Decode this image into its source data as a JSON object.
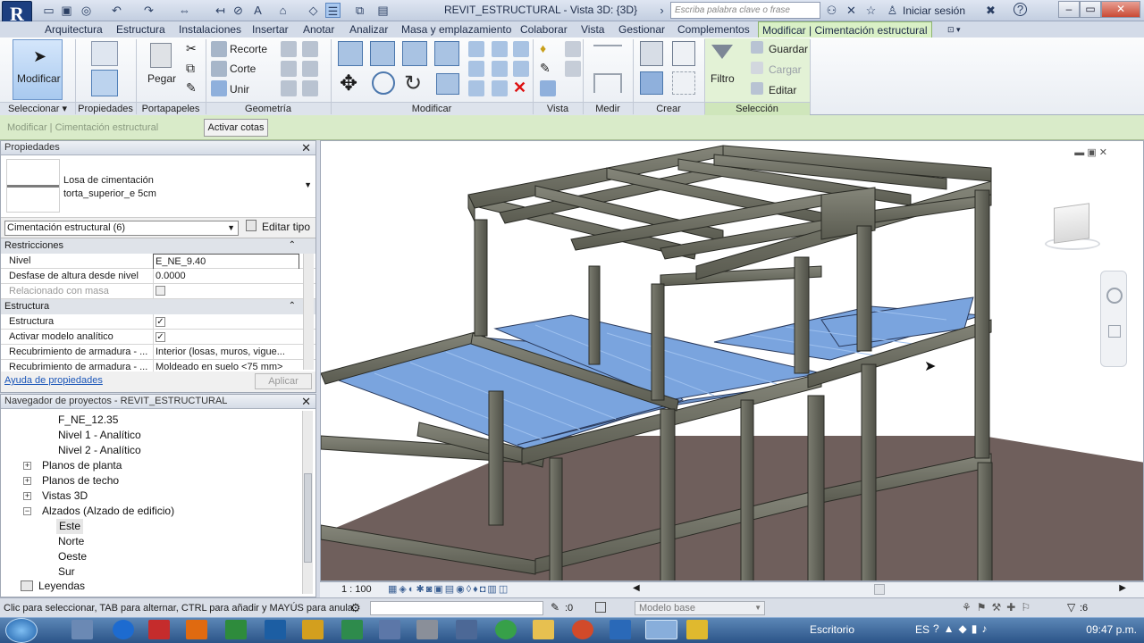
{
  "titlebar": {
    "title": "REVIT_ESTRUCTURAL - Vista 3D: {3D}",
    "search_placeholder": "Escriba palabra clave o frase",
    "signin": "Iniciar sesión"
  },
  "tabs": [
    "Arquitectura",
    "Estructura",
    "Instalaciones",
    "Insertar",
    "Anotar",
    "Analizar",
    "Masa y emplazamiento",
    "Colaborar",
    "Vista",
    "Gestionar",
    "Complementos",
    "Modificar | Cimentación estructural"
  ],
  "ribbon": {
    "modificar": "Modificar",
    "pegar": "Pegar",
    "recorte": "Recorte",
    "corte": "Corte",
    "unir": "Unir",
    "filtro": "Filtro",
    "guardar": "Guardar",
    "cargar": "Cargar",
    "editar": "Editar",
    "panels": {
      "seleccionar": "Seleccionar",
      "propiedades": "Propiedades",
      "portapapeles": "Portapapeles",
      "geometria": "Geometría",
      "modificar": "Modificar",
      "vista": "Vista",
      "medir": "Medir",
      "crear": "Crear",
      "seleccion": "Selección"
    }
  },
  "options_bar": {
    "context": "Modificar | Cimentación estructural",
    "activar_cotas": "Activar cotas"
  },
  "properties": {
    "header": "Propiedades",
    "type_line1": "Losa de cimentación",
    "type_line2": "torta_superior_e 5cm",
    "selector": "Cimentación estructural (6)",
    "edit_type": "Editar tipo",
    "groups": {
      "restricciones": "Restricciones",
      "estructura": "Estructura"
    },
    "rows": [
      {
        "label": "Nivel",
        "value": "E_NE_9.40"
      },
      {
        "label": "Desfase de altura desde nivel",
        "value": "0.0000"
      },
      {
        "label": "Relacionado con masa",
        "value": ""
      },
      {
        "label": "Estructura",
        "value": ""
      },
      {
        "label": "Activar modelo analítico",
        "value": ""
      },
      {
        "label": "Recubrimiento de armadura - ...",
        "value": "Interior (losas, muros, vigue..."
      },
      {
        "label": "Recubrimiento de armadura - ...",
        "value": "Moldeado en suelo <75 mm>"
      }
    ],
    "help": "Ayuda de propiedades",
    "apply": "Aplicar"
  },
  "browser": {
    "header": "Navegador de proyectos - REVIT_ESTRUCTURAL",
    "items": [
      "F_NE_12.35",
      "Nivel 1 - Analítico",
      "Nivel 2 - Analítico",
      "Planos de planta",
      "Planos de techo",
      "Vistas 3D",
      "Alzados (Alzado de edificio)",
      "Este",
      "Norte",
      "Oeste",
      "Sur",
      "Leyendas"
    ]
  },
  "viewbar": {
    "scale": "1 : 100"
  },
  "statusbar": {
    "message": "Clic para seleccionar, TAB para alternar, CTRL para añadir y MAYÚS para anula",
    "selection_count": ":0",
    "model": "Modelo base",
    "filter_count": ":6"
  },
  "taskbar": {
    "desktop": "Escritorio",
    "lang": "ES",
    "clock": "09:47 p.m."
  },
  "colors": {
    "accent_tab": "#d9f0c6",
    "concrete": "#6d6e62",
    "slab": "#7aa4de"
  }
}
